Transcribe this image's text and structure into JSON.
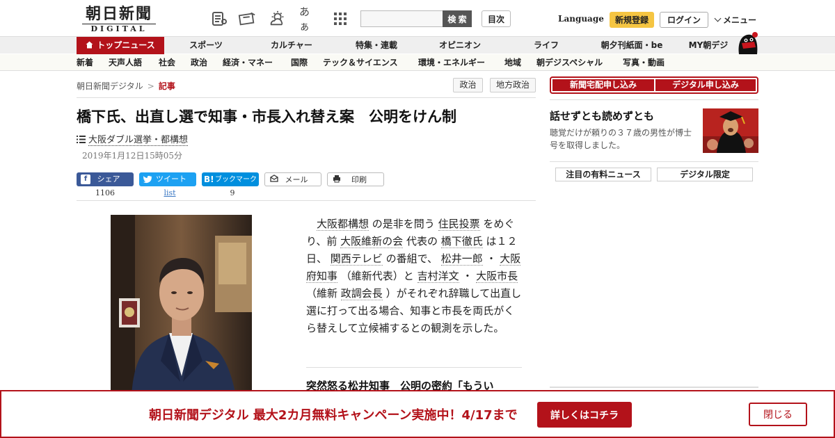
{
  "header": {
    "logo_jp": "朝日新聞",
    "logo_en": "DIGITAL",
    "search_button": "検 索",
    "toc_button": "目次",
    "language": "Language",
    "register": "新規登録",
    "login": "ログイン",
    "menu": "メニュー",
    "fontsize_icon_text": "あぁ"
  },
  "main_nav": [
    "トップニュース",
    "スポーツ",
    "カルチャー",
    "特集・連載",
    "オピニオン",
    "ライフ",
    "朝夕刊紙面・be",
    "MY朝デジ"
  ],
  "sub_nav": [
    "新着",
    "天声人語",
    "社会",
    "政治",
    "経済・マネー",
    "国際",
    "テック＆サイエンス",
    "環境・エネルギー",
    "地域",
    "朝デジスペシャル",
    "写真・動画"
  ],
  "breadcrumb": {
    "home": "朝日新聞デジタル",
    "sep": ">",
    "current": "記事"
  },
  "tags": [
    "政治",
    "地方政治"
  ],
  "article": {
    "headline": "橋下氏、出直し選で知事・市長入れ替え案　公明をけん制",
    "series": "大阪ダブル選挙・都構想",
    "date": "2019年1月12日15時05分",
    "body": [
      {
        "t": "　"
      },
      {
        "t": "大阪都構想",
        "link": true
      },
      {
        "t": " の是非を問う "
      },
      {
        "t": "住民投票",
        "link": true
      },
      {
        "t": " をめぐり、前 "
      },
      {
        "t": "大阪維新の会",
        "link": true
      },
      {
        "t": " 代表の "
      },
      {
        "t": "橋下徹氏",
        "link": true
      },
      {
        "t": " は１２日、 "
      },
      {
        "t": "関西テレビ",
        "link": true
      },
      {
        "t": " の番組で、 "
      },
      {
        "t": "松井一郎",
        "link": true
      },
      {
        "t": " ・ "
      },
      {
        "t": "大阪府知事",
        "link": true
      },
      {
        "t": " （維新代表）と "
      },
      {
        "t": "吉村洋文",
        "link": true
      },
      {
        "t": " ・ "
      },
      {
        "t": "大阪市長",
        "link": true
      },
      {
        "t": " （維新 "
      },
      {
        "t": "政調会長",
        "link": true
      },
      {
        "t": " ）がそれぞれ辞職して出直し選に打って出る場合、知事と市長を両氏がくら替えして立候補するとの観測を示した。"
      }
    ],
    "related_title": "突然怒る松井知事　公明の密約「もうい"
  },
  "share": {
    "facebook": {
      "label": "シェア",
      "count": "1106"
    },
    "twitter": {
      "label": "ツイート",
      "count": "list"
    },
    "hatena": {
      "label": "ブックマーク",
      "count": "9"
    },
    "mail": "メール",
    "print": "印刷"
  },
  "sidebar": {
    "subscribe_paper": "新聞宅配申し込み",
    "subscribe_digital": "デジタル申し込み",
    "promo_title": "話せずとも読めずとも",
    "promo_desc": "聴覚だけが頼りの３７歳の男性が博士号を取得しました。",
    "tab_paid": "注目の有料ニュース",
    "tab_digital": "デジタル限定"
  },
  "banner": {
    "text": "朝日新聞デジタル 最大2カ月無料キャンペーン実施中！4/17まで",
    "cta": "詳しくはコチラ",
    "close": "閉じる"
  },
  "colors": {
    "brand_red": "#b3121a",
    "register_yellow": "#f5c542",
    "facebook": "#3b5998",
    "twitter": "#1da1f2",
    "hatena": "#008fde"
  }
}
